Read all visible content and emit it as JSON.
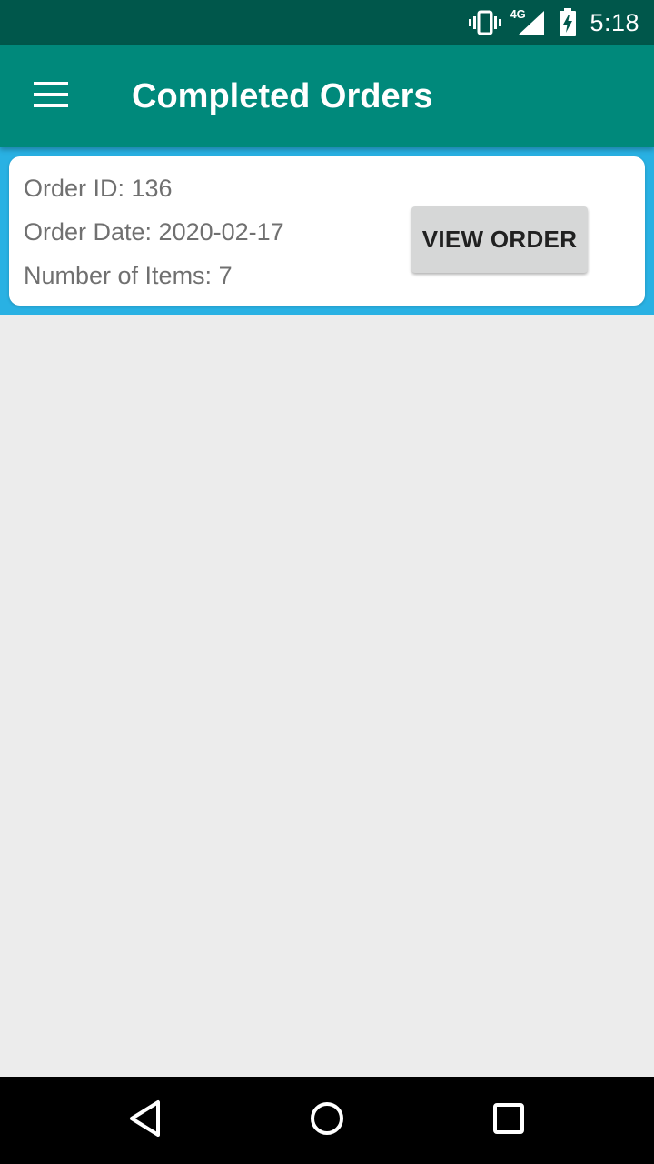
{
  "status_bar": {
    "time": "5:18",
    "network_label": "4G",
    "icons": [
      "vibrate-icon",
      "signal-icon",
      "battery-charging-icon"
    ]
  },
  "app_bar": {
    "title": "Completed Orders",
    "menu_icon": "hamburger-menu-icon"
  },
  "orders": [
    {
      "id_line": "Order ID: 136",
      "date_line": "Order Date: 2020-02-17",
      "items_line": "Number of Items: 7",
      "button_label": "VIEW ORDER"
    }
  ],
  "nav_bar": {
    "icons": [
      "back-icon",
      "home-icon",
      "recents-icon"
    ]
  },
  "colors": {
    "status_bar": "#00574b",
    "app_bar": "#00897b",
    "list_background": "#29b1e3",
    "page_background": "#ececec",
    "button_background": "#d6d7d7"
  }
}
